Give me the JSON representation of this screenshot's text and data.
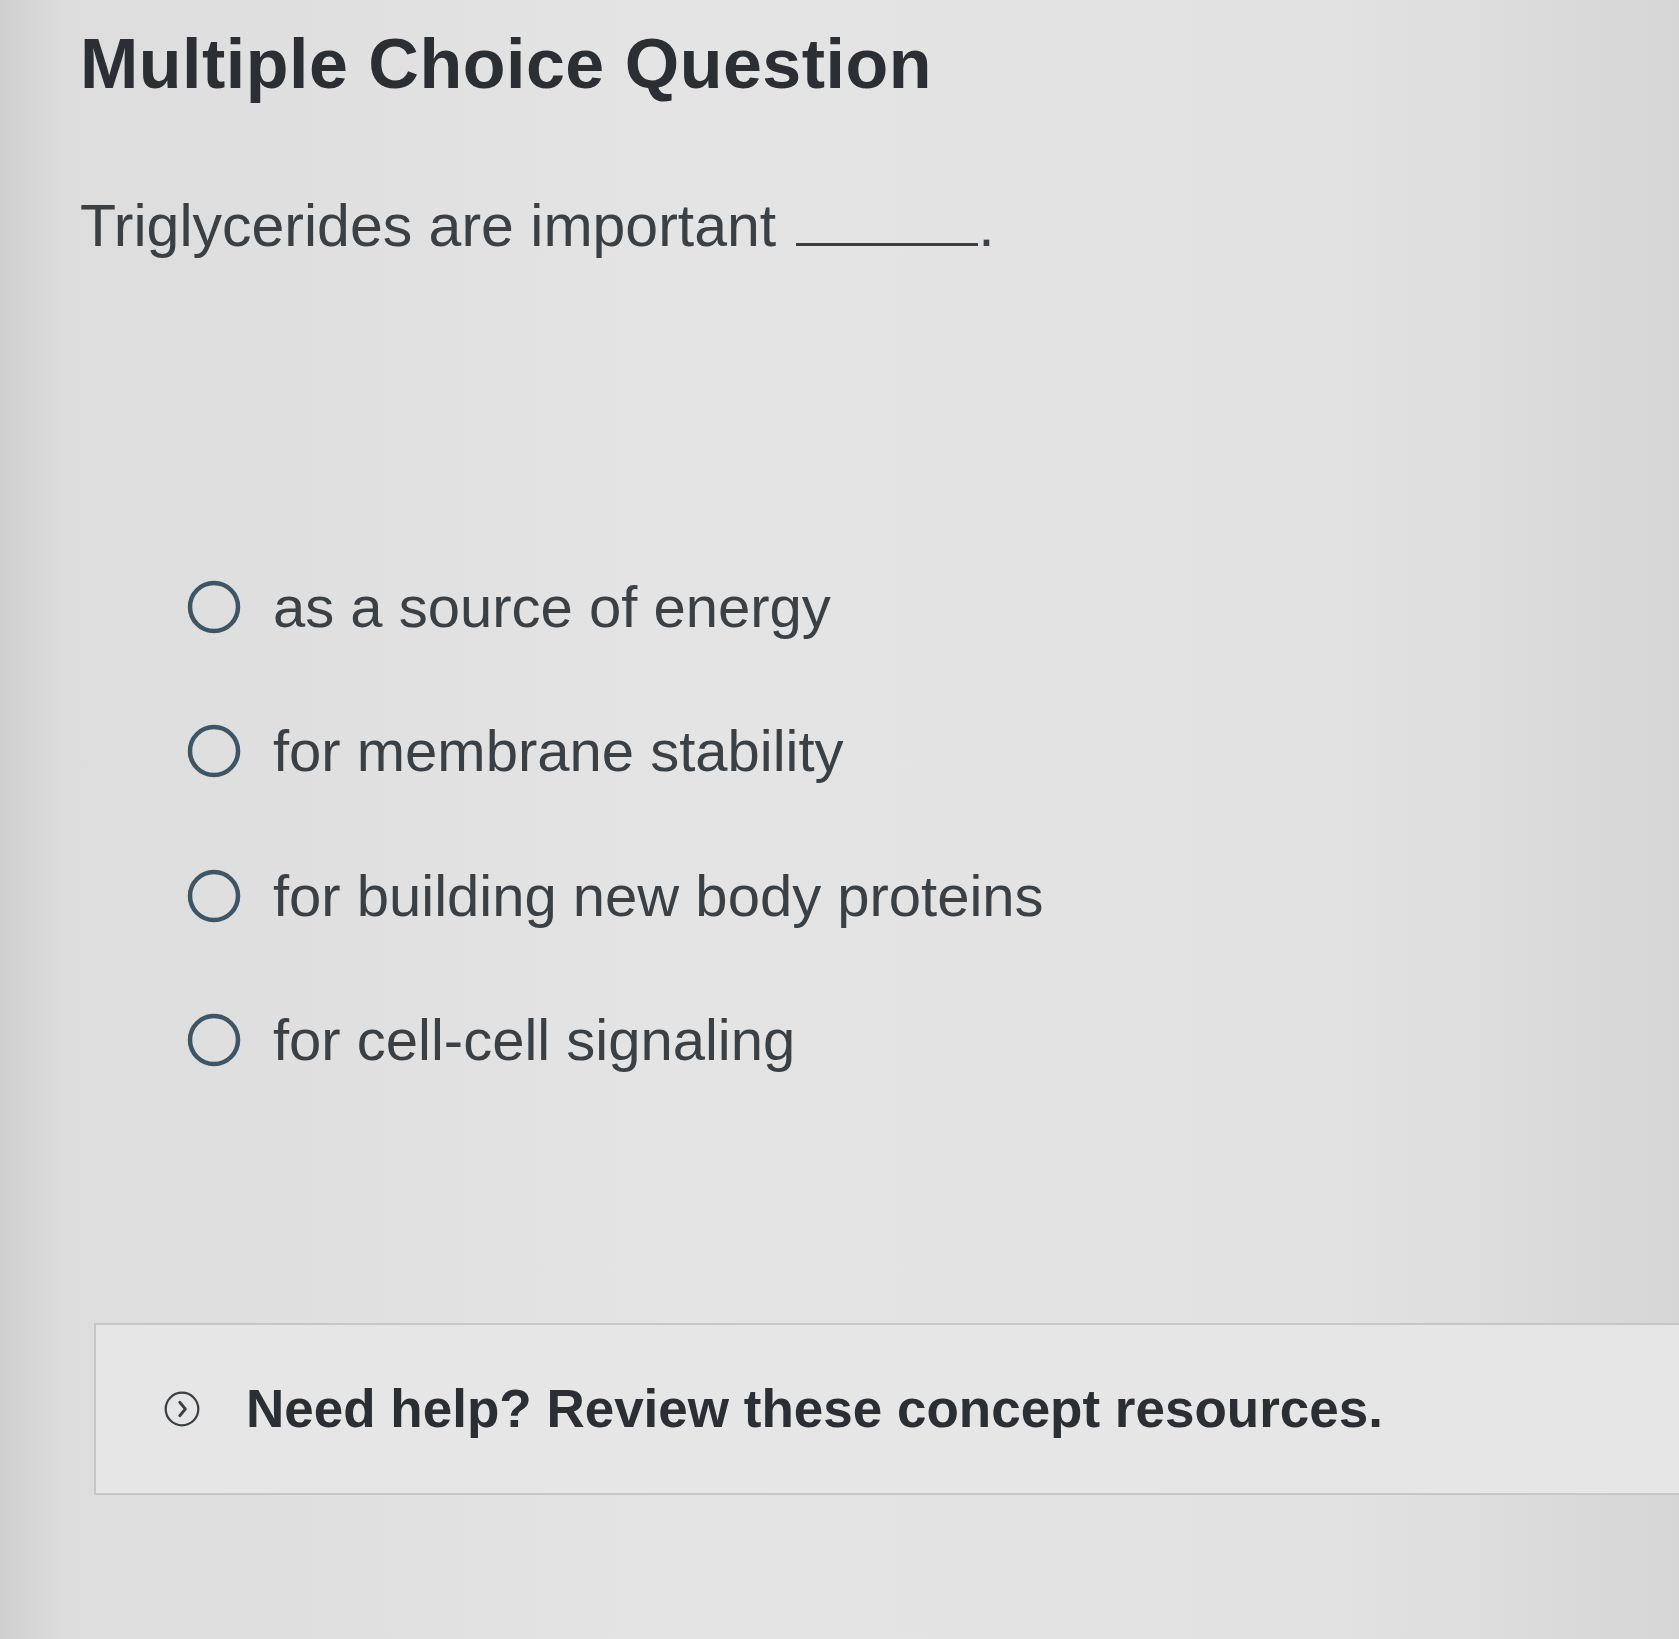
{
  "title": "Multiple Choice Question",
  "question": {
    "text_before": "Triglycerides are important",
    "text_after": "."
  },
  "options": [
    {
      "text": "as a source of energy",
      "selected": false
    },
    {
      "text": "for membrane stability",
      "selected": false
    },
    {
      "text": "for building new body proteins",
      "selected": false
    },
    {
      "text": "for cell-cell signaling",
      "selected": false
    }
  ],
  "help": {
    "text": "Need help? Review these concept resources.",
    "expanded": false
  }
}
